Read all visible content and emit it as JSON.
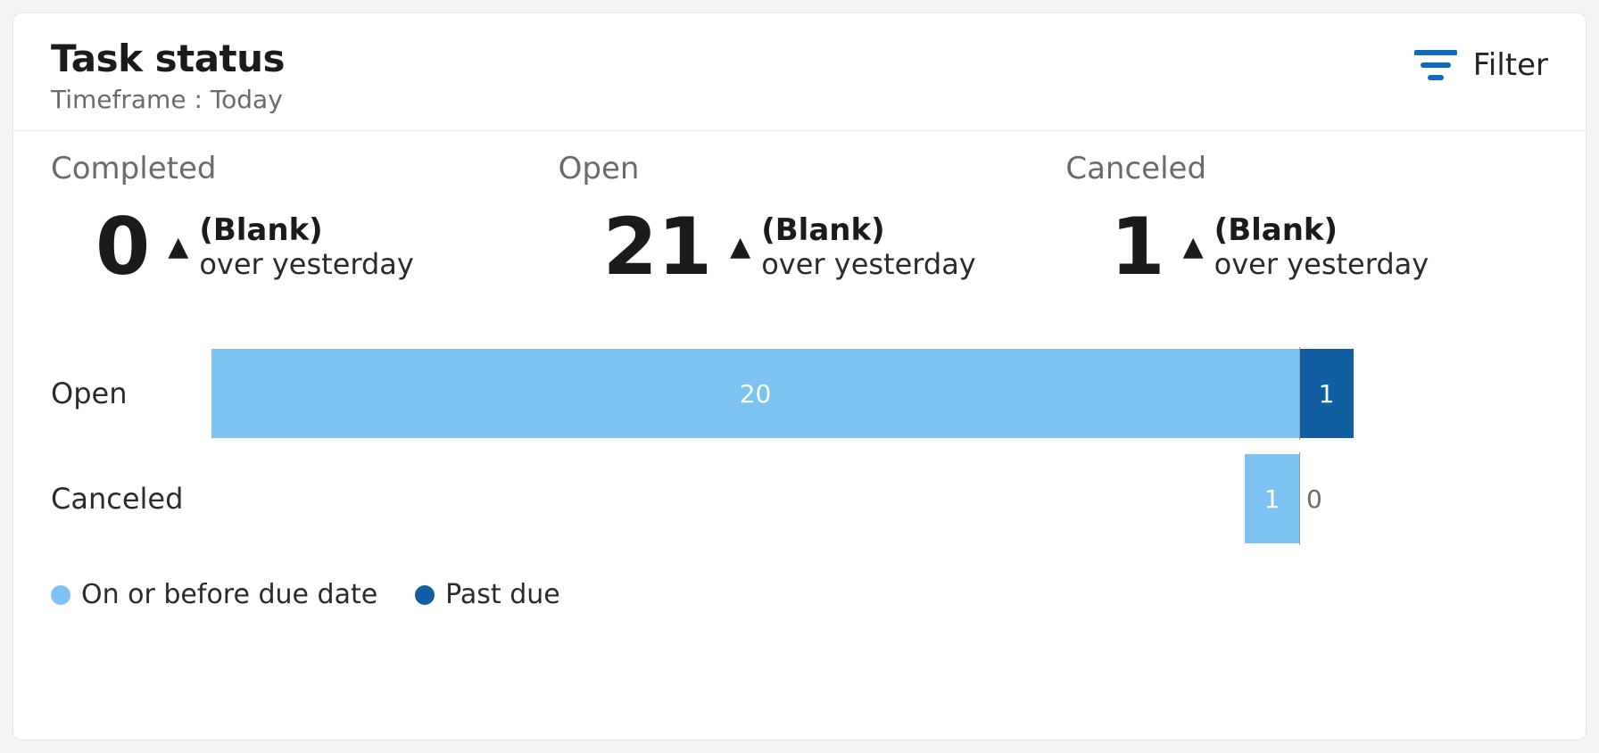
{
  "header": {
    "title": "Task status",
    "subtitle": "Timeframe : Today",
    "filter_label": "Filter"
  },
  "kpis": [
    {
      "label": "Completed",
      "value": "0",
      "delta_value": "(Blank)",
      "delta_caption": "over yesterday"
    },
    {
      "label": "Open",
      "value": "21",
      "delta_value": "(Blank)",
      "delta_caption": "over yesterday"
    },
    {
      "label": "Canceled",
      "value": "1",
      "delta_value": "(Blank)",
      "delta_caption": "over yesterday"
    }
  ],
  "legend": {
    "on_or_before": "On or before due date",
    "past_due": "Past due"
  },
  "colors": {
    "light": "#7cc2f2",
    "dark": "#115ea3",
    "accent": "#0f6cbd"
  },
  "chart_data": {
    "type": "bar",
    "orientation": "horizontal",
    "stacked": true,
    "categories": [
      "Open",
      "Canceled"
    ],
    "series": [
      {
        "name": "On or before due date",
        "values": [
          20,
          1
        ],
        "color": "#7cc2f2"
      },
      {
        "name": "Past due",
        "values": [
          1,
          0
        ],
        "color": "#115ea3"
      }
    ],
    "xlim": [
      0,
      21
    ],
    "xlabel": "",
    "ylabel": "",
    "title": ""
  }
}
